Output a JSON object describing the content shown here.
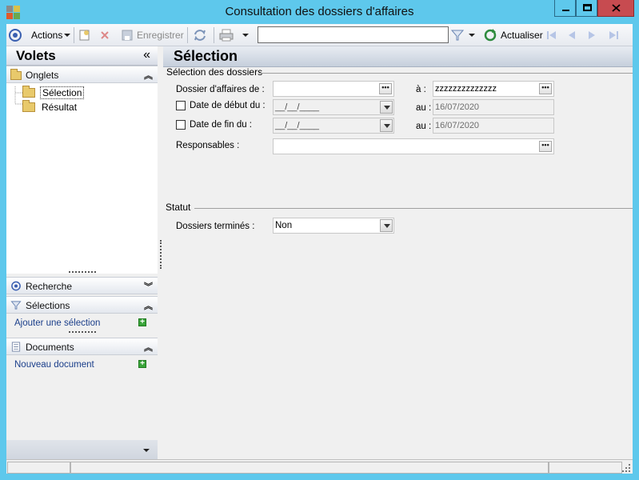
{
  "window": {
    "title": "Consultation des dossiers d'affaires",
    "controls": [
      "minimize",
      "maximize",
      "close"
    ]
  },
  "toolbar": {
    "actions_label": "Actions",
    "save_label": "Enregistrer",
    "search_value": "",
    "refresh_label": "Actualiser"
  },
  "left_pane": {
    "title": "Volets",
    "collapse_glyph": "«",
    "tabs_section": {
      "label": "Onglets",
      "items": [
        {
          "label": "Sélection",
          "selected": true
        },
        {
          "label": "Résultat",
          "selected": false
        }
      ]
    },
    "search_section": {
      "label": "Recherche"
    },
    "selections_section": {
      "label": "Sélections",
      "link": "Ajouter une sélection"
    },
    "documents_section": {
      "label": "Documents",
      "link": "Nouveau document"
    }
  },
  "main": {
    "title": "Sélection",
    "group_selection": {
      "title": "Sélection des dossiers",
      "dossier_label": "Dossier d'affaires de :",
      "dossier_from": "",
      "a_label": "à :",
      "dossier_to": "zzzzzzzzzzzzzz",
      "start_date_label": "Date de début du :",
      "start_date_value": "__/__/____",
      "start_au_label": "au :",
      "start_au_value": "16/07/2020",
      "end_date_label": "Date de fin du :",
      "end_date_value": "__/__/____",
      "end_au_label": "au :",
      "end_au_value": "16/07/2020",
      "responsables_label": "Responsables :",
      "responsables_value": ""
    },
    "group_status": {
      "title": "Statut",
      "done_label": "Dossiers terminés :",
      "done_value": "Non"
    }
  },
  "colors": {
    "window_frame": "#5ec8ec",
    "close_button": "#c74b50",
    "link": "#1a3e8a"
  }
}
